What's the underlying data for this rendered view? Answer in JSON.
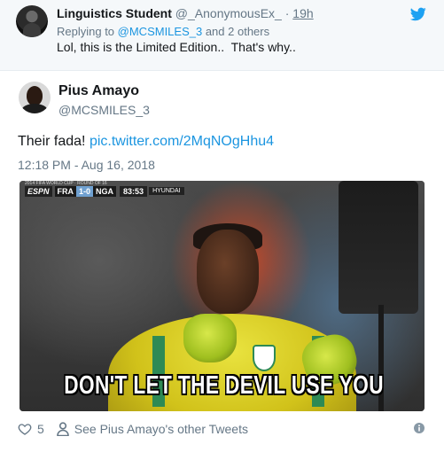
{
  "reply": {
    "name": "Linguistics Student",
    "handle": "@_AnonymousEx_",
    "separator": "·",
    "time": "19h",
    "replying_prefix": "Replying to ",
    "replying_mention": "@MCSMILES_3",
    "replying_suffix": " and 2 others",
    "text": "Lol, this is the Limited Edition..  That's why.."
  },
  "main_tweet": {
    "name": "Pius Amayo",
    "handle": "@MCSMILES_3",
    "text_prefix": "Their fada! ",
    "text_link": "pic.twitter.com/2MqNOgHhu4",
    "timestamp": "12:18 PM - Aug 16, 2018",
    "like_count": "5",
    "see_other_label": "See Pius Amayo's other Tweets"
  },
  "media": {
    "caption": "DON'T LET THE DEVIL USE YOU",
    "scorebug": {
      "competition": "2014 FIFA WORLD CUP · ROUND OF 16",
      "broadcaster": "ESPN",
      "team_home": "FRA",
      "score": "1-0",
      "team_away": "NGA",
      "clock": "83:53",
      "sponsor": "HYUNDAI"
    }
  },
  "icons": {
    "brand_logo": "twitter-bird-icon",
    "like": "heart-icon",
    "profile": "person-icon",
    "info": "info-icon"
  },
  "colors": {
    "link": "#1b95e0",
    "twitter_blue": "#1da1f2",
    "secondary_text": "#657786",
    "reply_background": "#f5f8fa"
  }
}
